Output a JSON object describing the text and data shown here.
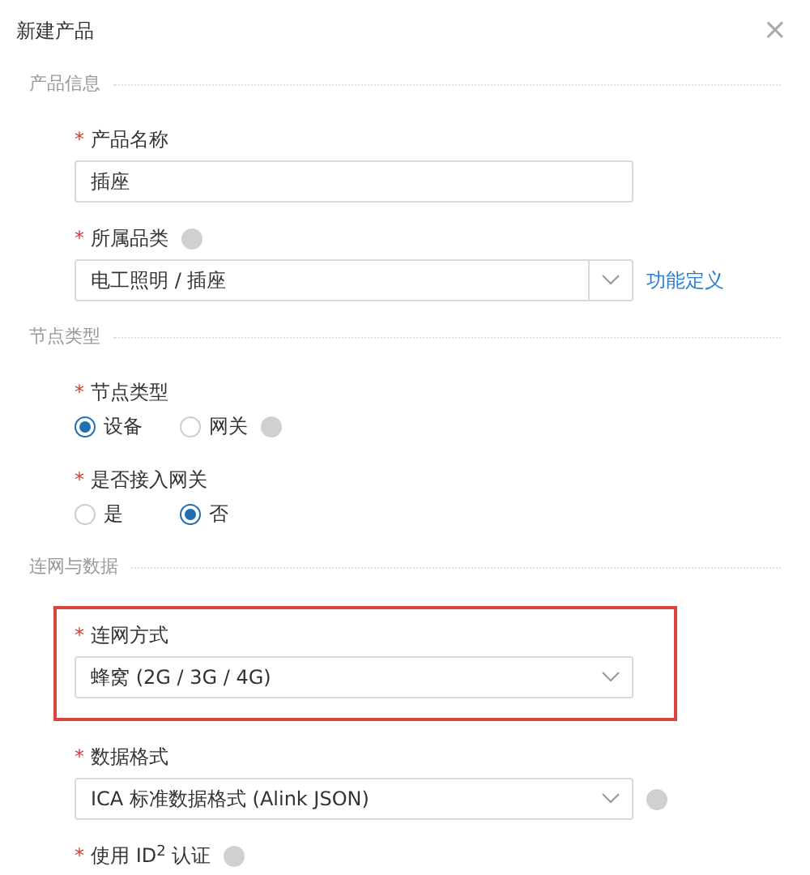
{
  "dialog": {
    "title": "新建产品",
    "close": "×"
  },
  "sections": [
    {
      "title": "产品信息",
      "fields": [
        {
          "kind": "input",
          "mark": "*",
          "label": "产品名称",
          "help": false,
          "value": "插座",
          "highlighted": false
        },
        {
          "kind": "select",
          "mark": "*",
          "label": "所属品类",
          "help": true,
          "value": "电工照明 / 插座",
          "link": "功能定义",
          "side_help": false,
          "highlighted": false
        }
      ]
    },
    {
      "title": "节点类型",
      "fields": [
        {
          "kind": "radio",
          "mark": "*",
          "label": "节点类型",
          "help": false,
          "highlighted": false,
          "options": [
            {
              "label": "设备",
              "selected": true,
              "help": false
            },
            {
              "label": "网关",
              "selected": false,
              "help": true
            }
          ]
        },
        {
          "kind": "radio",
          "mark": "*",
          "label": "是否接入网关",
          "help": false,
          "highlighted": false,
          "options": [
            {
              "label": "是",
              "selected": false,
              "help": false
            },
            {
              "label": "否",
              "selected": true,
              "help": false
            }
          ]
        }
      ]
    },
    {
      "title": "连网与数据",
      "fields": [
        {
          "kind": "select",
          "mark": "*",
          "label": "连网方式",
          "help": false,
          "value": "蜂窝 (2G / 3G / 4G)",
          "side_help": false,
          "highlighted": true
        },
        {
          "kind": "select",
          "mark": "*",
          "label": "数据格式",
          "help": false,
          "value": "ICA 标准数据格式 (Alink JSON)",
          "side_help": true,
          "highlighted": false
        },
        {
          "kind": "label",
          "mark": "*",
          "label": "使用 ID$^{2}$ 认证",
          "help": true,
          "highlighted": false
        }
      ]
    }
  ]
}
